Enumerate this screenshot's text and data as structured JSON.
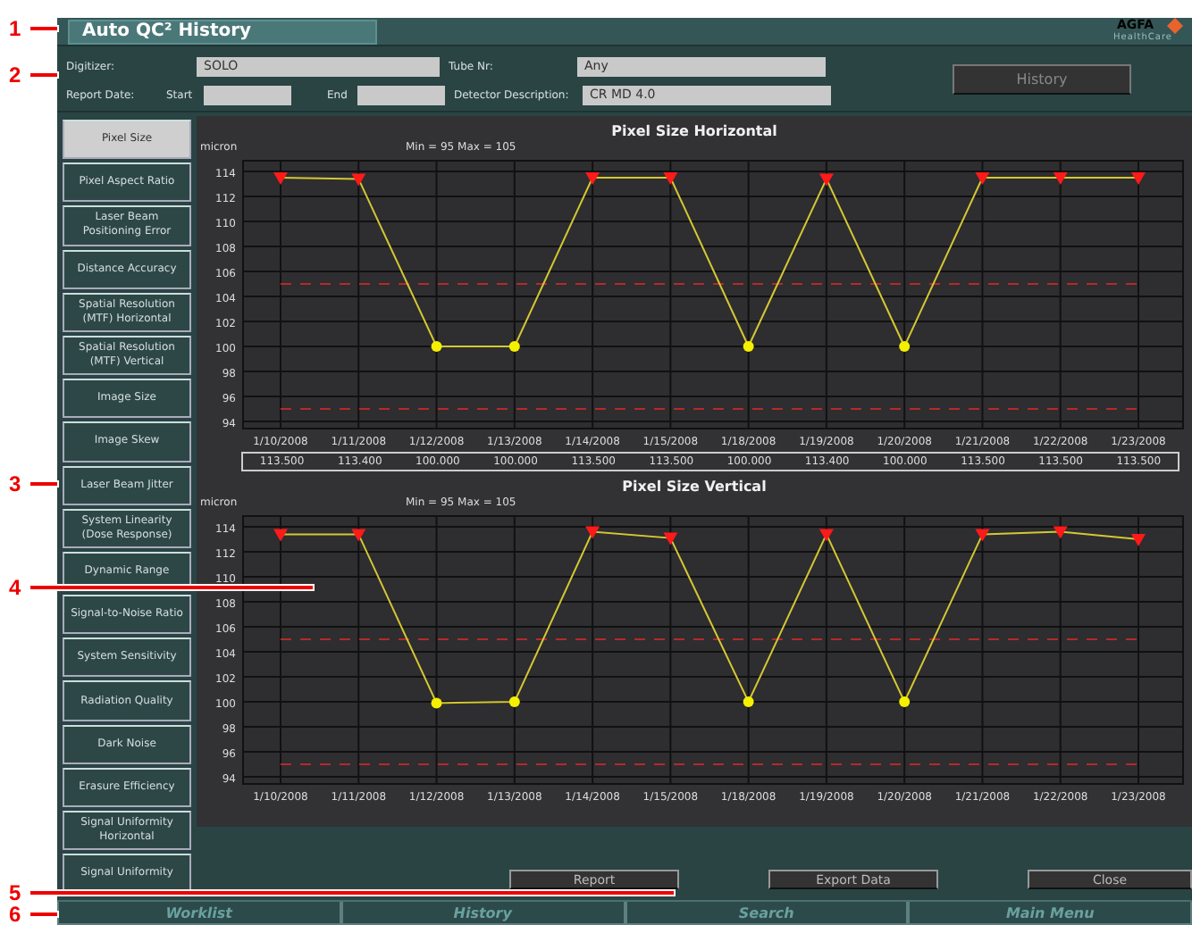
{
  "window": {
    "title": "Auto QC² History"
  },
  "brand": {
    "logo": "AGFA",
    "sub": "HealthCare"
  },
  "header": {
    "digitizer": {
      "label": "Digitizer:",
      "value": "SOLO"
    },
    "tube": {
      "label": "Tube Nr:",
      "value": "Any"
    },
    "report_date": {
      "label": "Report Date:",
      "start_label": "Start",
      "end_label": "End"
    },
    "detector": {
      "label": "Detector Description:",
      "value": "CR MD 4.0"
    },
    "history_button": {
      "label": "History",
      "disabled": true
    }
  },
  "sidebar": {
    "items": [
      {
        "label": "Pixel Size",
        "selected": true
      },
      {
        "label": "Pixel Aspect Ratio",
        "selected": false
      },
      {
        "label": "Laser Beam Positioning  Error",
        "selected": false
      },
      {
        "label": "Distance Accuracy",
        "selected": false
      },
      {
        "label": "Spatial Resolution (MTF) Horizontal",
        "selected": false
      },
      {
        "label": "Spatial Resolution (MTF) Vertical",
        "selected": false
      },
      {
        "label": "Image Size",
        "selected": false
      },
      {
        "label": "Image Skew",
        "selected": false
      },
      {
        "label": "Laser Beam Jitter",
        "selected": false
      },
      {
        "label": "System Linearity (Dose Response)",
        "selected": false
      },
      {
        "label": "Dynamic Range",
        "selected": false
      },
      {
        "label": "Signal-to-Noise Ratio",
        "selected": false
      },
      {
        "label": "System Sensitivity",
        "selected": false
      },
      {
        "label": "Radiation Quality",
        "selected": false
      },
      {
        "label": "Dark Noise",
        "selected": false
      },
      {
        "label": "Erasure Efficiency",
        "selected": false
      },
      {
        "label": "Signal Uniformity Horizontal",
        "selected": false
      },
      {
        "label": "Signal Uniformity",
        "selected": false
      }
    ]
  },
  "charts": [
    {
      "limits_text": "Min = 95   Max = 105",
      "value_row": [
        "113.500",
        "113.400",
        "100.000",
        "100.000",
        "113.500",
        "113.500",
        "100.000",
        "113.400",
        "100.000",
        "113.500",
        "113.500",
        "113.500"
      ],
      "chart_data": {
        "type": "line",
        "title": "Pixel Size Horizontal",
        "ylabel": "micron",
        "categories": [
          "1/10/2008",
          "1/11/2008",
          "1/12/2008",
          "1/13/2008",
          "1/14/2008",
          "1/15/2008",
          "1/18/2008",
          "1/19/2008",
          "1/20/2008",
          "1/21/2008",
          "1/22/2008",
          "1/23/2008"
        ],
        "series": [
          {
            "color": "#d4c832",
            "marker": "triangle",
            "values": [
              113.5,
              113.4,
              100,
              100,
              113.5,
              113.5,
              100,
              113.4,
              100,
              113.5,
              113.5,
              113.5
            ]
          }
        ],
        "ylim": [
          94,
          114
        ],
        "yticks": [
          94,
          96,
          98,
          100,
          102,
          104,
          106,
          108,
          110,
          112,
          114
        ],
        "grid": true,
        "ref_lines": [
          {
            "axis": "y",
            "value": 105
          },
          {
            "axis": "y",
            "value": 95
          }
        ]
      }
    },
    {
      "limits_text": "Min = 95   Max = 105",
      "chart_data": {
        "type": "line",
        "title": "Pixel Size Vertical",
        "ylabel": "micron",
        "categories": [
          "1/10/2008",
          "1/11/2008",
          "1/12/2008",
          "1/13/2008",
          "1/14/2008",
          "1/15/2008",
          "1/18/2008",
          "1/19/2008",
          "1/20/2008",
          "1/21/2008",
          "1/22/2008",
          "1/23/2008"
        ],
        "series": [
          {
            "color": "#d4c832",
            "marker": "triangle",
            "values": [
              113.4,
              113.4,
              99.9,
              100,
              113.6,
              113.1,
              100,
              113.4,
              100,
              113.4,
              113.6,
              113.0
            ]
          }
        ],
        "ylim": [
          94,
          114
        ],
        "yticks": [
          94,
          96,
          98,
          100,
          102,
          104,
          106,
          108,
          110,
          112,
          114
        ],
        "grid": true,
        "ref_lines": [
          {
            "axis": "y",
            "value": 105
          },
          {
            "axis": "y",
            "value": 95
          }
        ]
      }
    }
  ],
  "actions": [
    {
      "label": "Report"
    },
    {
      "label": "Export Data"
    },
    {
      "label": "Close"
    }
  ],
  "taskbar": [
    {
      "label": "Worklist"
    },
    {
      "label": "History"
    },
    {
      "label": "Search"
    },
    {
      "label": "Main Menu"
    }
  ],
  "callouts": [
    {
      "label": "1"
    },
    {
      "label": "2"
    },
    {
      "label": "3"
    },
    {
      "label": "4"
    },
    {
      "label": "5"
    },
    {
      "label": "6"
    }
  ]
}
